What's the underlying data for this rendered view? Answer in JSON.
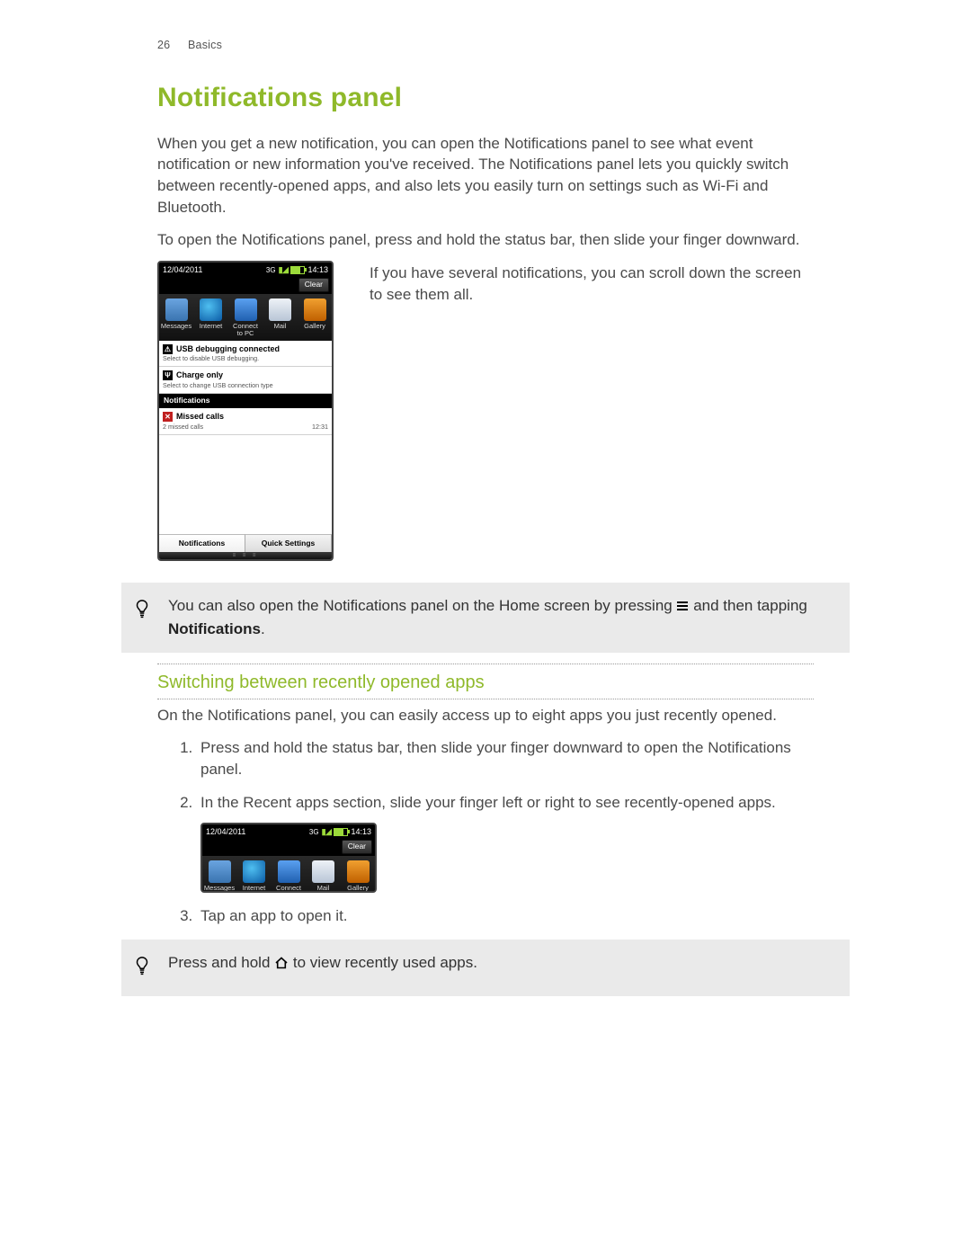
{
  "header": {
    "page_number": "26",
    "chapter": "Basics"
  },
  "title": "Notifications panel",
  "intro_p1": "When you get a new notification, you can open the Notifications panel to see what event notification or new information you've received. The Notifications panel lets you quickly switch between recently-opened apps, and also lets you easily turn on settings such as Wi-Fi and Bluetooth.",
  "intro_p2": "To open the Notifications panel, press and hold the status bar, then slide your finger downward.",
  "side_note": "If you have several notifications, you can scroll down the screen to see them all.",
  "screenshot1": {
    "date": "12/04/2011",
    "time": "14:13",
    "clear_label": "Clear",
    "apps": [
      {
        "label": "Messages"
      },
      {
        "label": "Internet"
      },
      {
        "label": "Connect to PC"
      },
      {
        "label": "Mail"
      },
      {
        "label": "Gallery"
      }
    ],
    "item1_title": "USB debugging connected",
    "item1_sub": "Select to disable USB debugging.",
    "item2_title": "Charge only",
    "item2_sub": "Select to change USB connection type",
    "section_header": "Notifications",
    "missed_title": "Missed calls",
    "missed_sub": "2 missed calls",
    "missed_time": "12:31",
    "tab_left": "Notifications",
    "tab_right": "Quick Settings"
  },
  "tip1_a": "You can also open the Notifications panel on the Home screen by pressing ",
  "tip1_b": " and then tapping ",
  "tip1_strong": "Notifications",
  "tip1_end": ".",
  "subheading": "Switching between recently opened apps",
  "sub_p1": "On the Notifications panel, you can easily access up to eight apps you just recently opened.",
  "steps": {
    "s1": "Press and hold the status bar, then slide your finger downward to open the Notifications panel.",
    "s2": "In the Recent apps section, slide your finger left or right to see recently-opened apps.",
    "s3": "Tap an app to open it."
  },
  "screenshot2": {
    "date": "12/04/2011",
    "time": "14:13",
    "clear_label": "Clear",
    "apps": [
      {
        "label": "Messages"
      },
      {
        "label": "Internet"
      },
      {
        "label": "Connect to PC"
      },
      {
        "label": "Mail"
      },
      {
        "label": "Gallery"
      }
    ]
  },
  "tip2_a": "Press and hold ",
  "tip2_b": " to view recently used apps."
}
